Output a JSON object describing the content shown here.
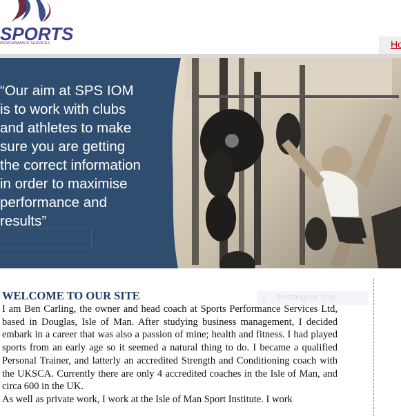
{
  "header": {
    "logo_text": "SPORTS",
    "logo_subtext": "PERFORMANCE SERVICES",
    "nav_first_item": "Ho"
  },
  "banner": {
    "quote_lines": [
      "“Our aim at SPS IOM",
      "is to work with clubs",
      "and athletes to make",
      "sure you are getting",
      "the correct information",
      "in order to maximise",
      "performance and",
      "results”"
    ],
    "colors": {
      "panel": "#2f4d6e",
      "text": "#ffffff"
    }
  },
  "sidebar_widget": {
    "label": "Rectangular Snip"
  },
  "main": {
    "heading": "WELCOME TO OUR SITE",
    "paragraph": "I am Ben Carling, the owner and head coach at Sports Performance Services Ltd, based in Douglas, Isle of Man. After studying business management, I decided embark in a career that was also a passion of mine; health and fitness. I had played sports from an early age so it seemed a natural thing to do. I became a qualified Personal Trainer, and latterly an accredited Strength and Conditioning coach with the UKSCA. Currently there are only 4 accredited coaches in the Isle of Man, and circa 600 in the UK.",
    "paragraph2": "As well as private work, I work at the Isle of Man Sport Institute. I work"
  }
}
